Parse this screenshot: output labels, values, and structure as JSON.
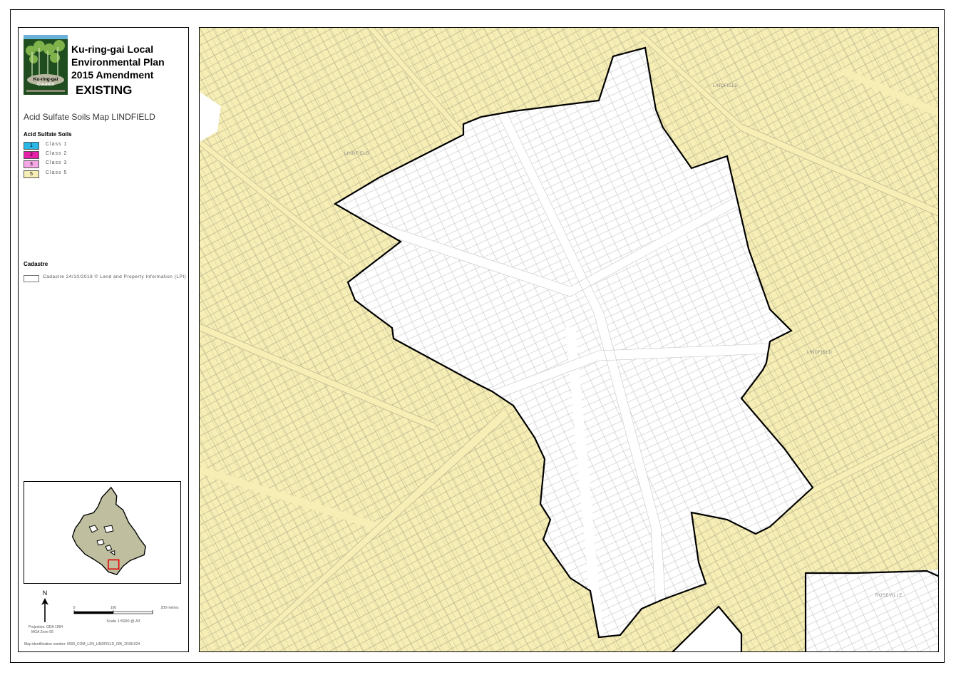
{
  "plan": {
    "title_line1": "Ku-ring-gai Local",
    "title_line2": "Environmental Plan",
    "title_line3": "2015 Amendment",
    "status": "EXISTING",
    "council_logo_text": "Ku-ring-gai Council"
  },
  "map_name": "Acid Sulfate Soils Map LINDFIELD",
  "legend": {
    "heading": "Acid Sulfate Soils",
    "classes": [
      {
        "code": "1",
        "label": "Class 1",
        "color": "#29b7e6"
      },
      {
        "code": "2",
        "label": "Class 2",
        "color": "#e620a8"
      },
      {
        "code": "3",
        "label": "Class 3",
        "color": "#f6a8e6"
      },
      {
        "code": "5",
        "label": "Class 5",
        "color": "#f6eeb4"
      }
    ],
    "cadastre_heading": "Cadastre",
    "cadastre_label": "Cadastre 24/10/2018 © Land and Property Information (LPI)"
  },
  "north_label": "N",
  "projection_line1": "Projection: GDA 1994",
  "projection_line2": "MGA Zone 56",
  "scale": {
    "ticks": [
      "0",
      "100",
      "200 metres"
    ],
    "text": "Scale 1:5000 @ A3"
  },
  "map_id": "Map identification number: 6500_COM_LZN_LINDFIELD_005_20181024",
  "suburb_labels": [
    "LINDFIELD",
    "LINDFIELD",
    "LINDFIELD",
    "ROSEVILLE"
  ],
  "colors": {
    "class5_fill": "#f6eeb4",
    "parcel_line": "#b8b18e",
    "boundary": "#000000"
  }
}
